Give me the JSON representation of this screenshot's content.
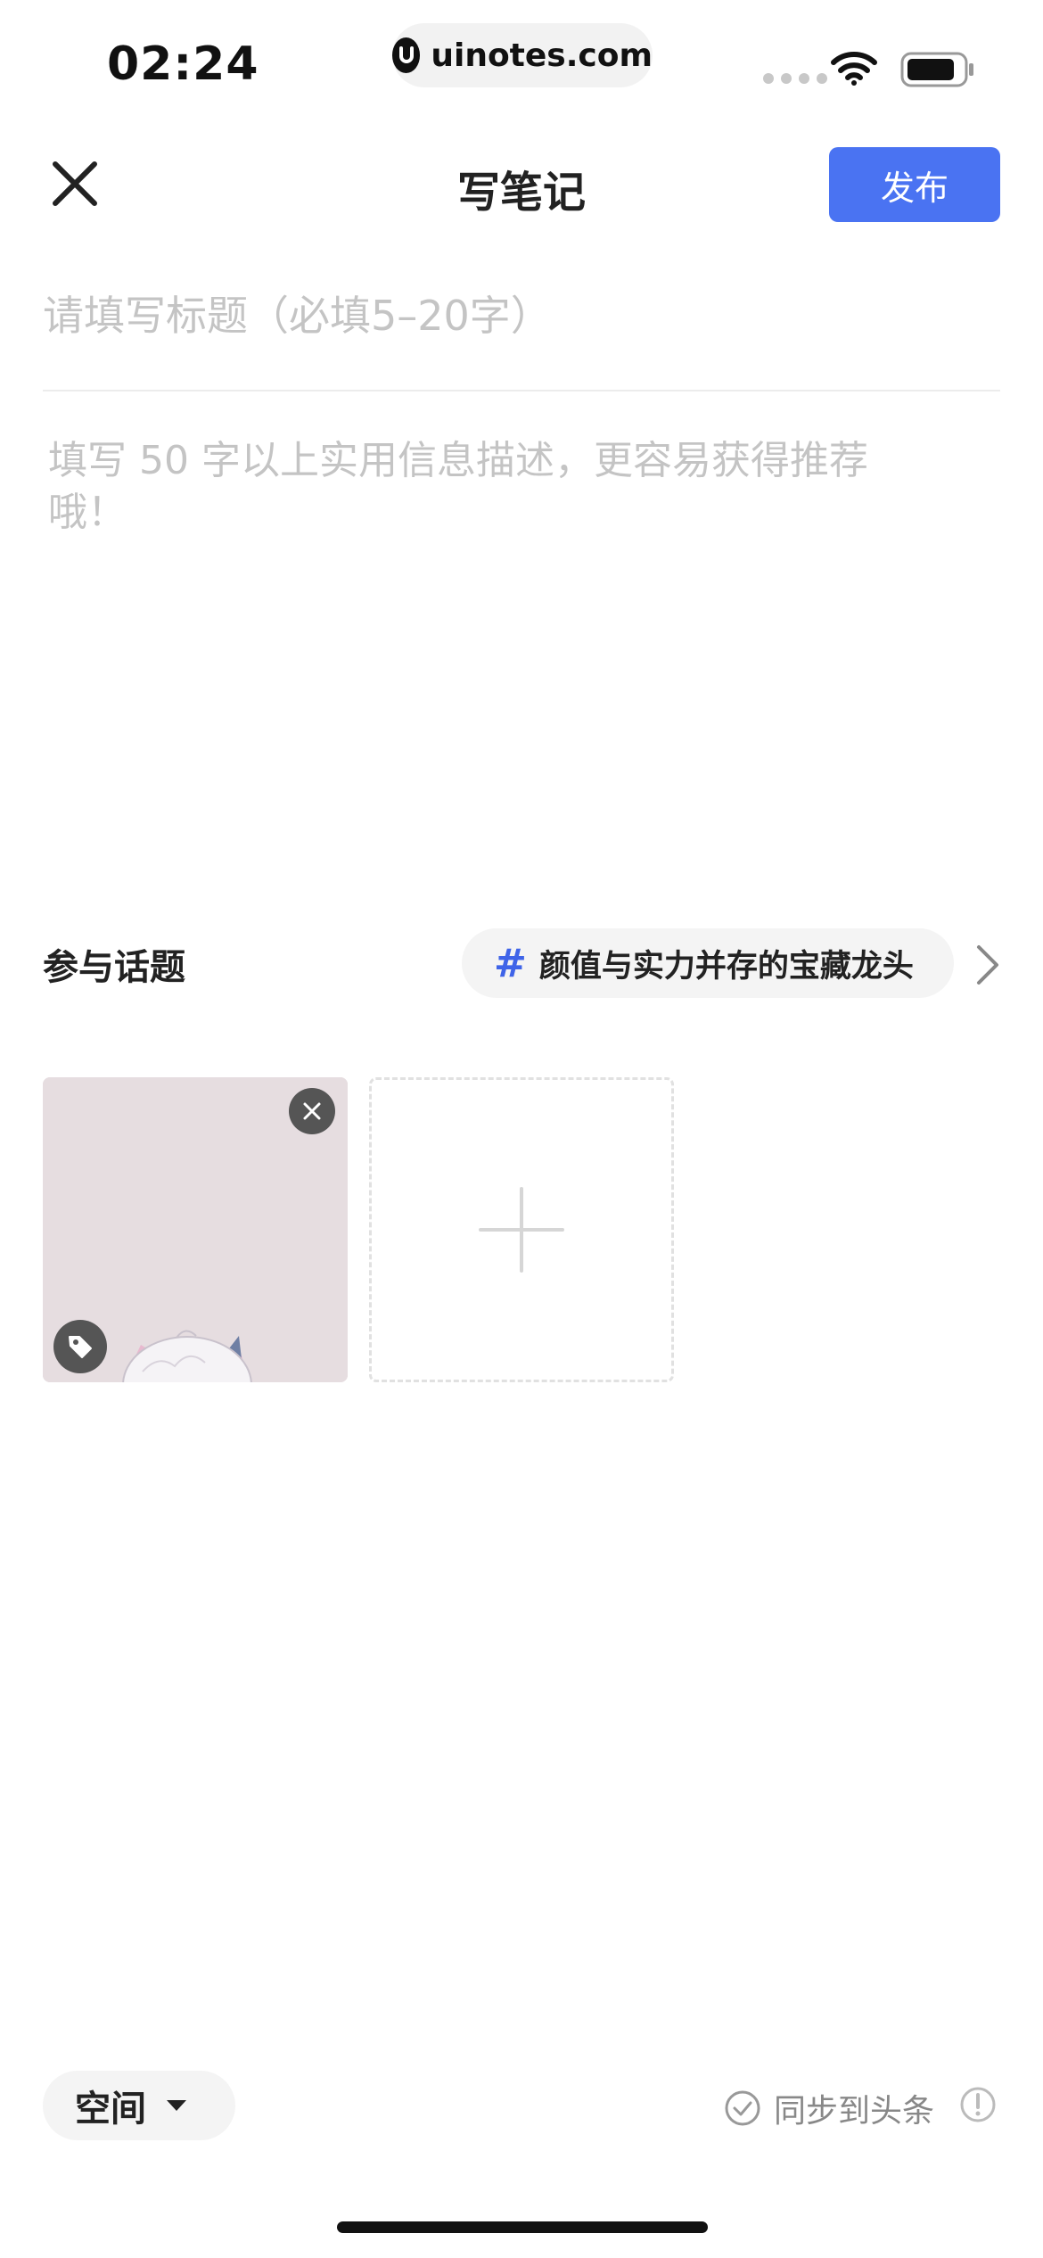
{
  "status_bar": {
    "time": "02:24",
    "site": "uinotes.com",
    "icons": [
      "signal-dots-icon",
      "wifi-icon",
      "battery-icon"
    ]
  },
  "nav": {
    "close_icon": "close-icon",
    "title": "写笔记",
    "publish_label": "发布"
  },
  "editor": {
    "title_placeholder": "请填写标题（必填5–20字）",
    "title_value": "",
    "description_placeholder": "填写 50 字以上实用信息描述，更容易获得推荐哦！",
    "description_value": ""
  },
  "topic": {
    "label": "参与话题",
    "hash": "#",
    "selected": "颜值与实力并存的宝藏龙头"
  },
  "images": {
    "thumbnail_icons": [
      "close-icon",
      "tag-icon"
    ],
    "add_icon": "plus-icon"
  },
  "bottom_bar": {
    "space_label": "空间",
    "sync_label": "同步到头条",
    "sync_checked": false
  },
  "colors": {
    "accent": "#4a73f2",
    "hash": "#3f64e8",
    "placeholder": "#c4c4c4",
    "chip_bg": "#f4f4f4"
  }
}
